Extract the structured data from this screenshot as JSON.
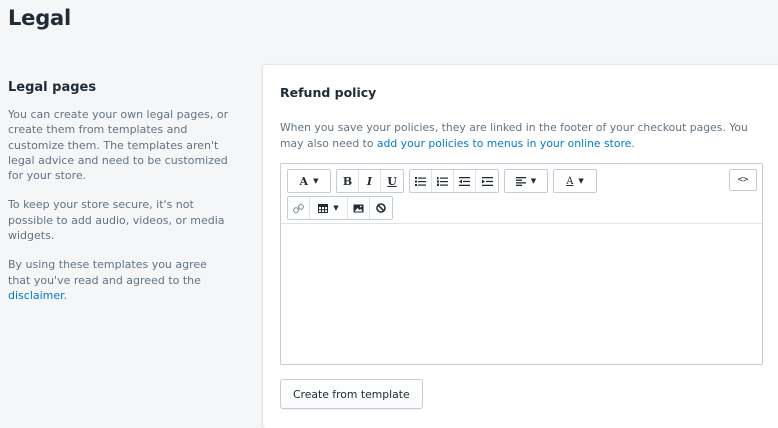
{
  "page": {
    "title": "Legal"
  },
  "sidebar": {
    "heading": "Legal pages",
    "para1": "You can create your own legal pages, or create them from templates and customize them. The templates aren't legal advice and need to be customized for your store.",
    "para2": "To keep your store secure, it's not possible to add audio, videos, or media widgets.",
    "para3_prefix": "By using these templates you agree that you've read and agreed to the ",
    "para3_link": "disclaimer",
    "para3_suffix": "."
  },
  "card": {
    "title": "Refund policy",
    "desc_prefix": "When you save your policies, they are linked in the footer of your checkout pages. You may also need to ",
    "desc_link": "add your policies to menus in your online store",
    "desc_suffix": "."
  },
  "toolbar": {
    "font_label": "A",
    "bold_label": "B",
    "italic_label": "I",
    "underline_label": "U",
    "text_color_label": "A",
    "code_label": "<>",
    "icons": [
      "font-icon",
      "bold-icon",
      "italic-icon",
      "underline-icon",
      "bulleted-list-icon",
      "numbered-list-icon",
      "outdent-icon",
      "indent-icon",
      "align-icon",
      "text-color-icon",
      "html-code-icon",
      "link-icon",
      "table-icon",
      "image-icon",
      "clear-formatting-icon"
    ]
  },
  "editor": {
    "content": ""
  },
  "actions": {
    "create_template_label": "Create from template"
  },
  "colors": {
    "link": "#007ace",
    "background": "#f4f6f8",
    "muted_text": "#637381"
  }
}
